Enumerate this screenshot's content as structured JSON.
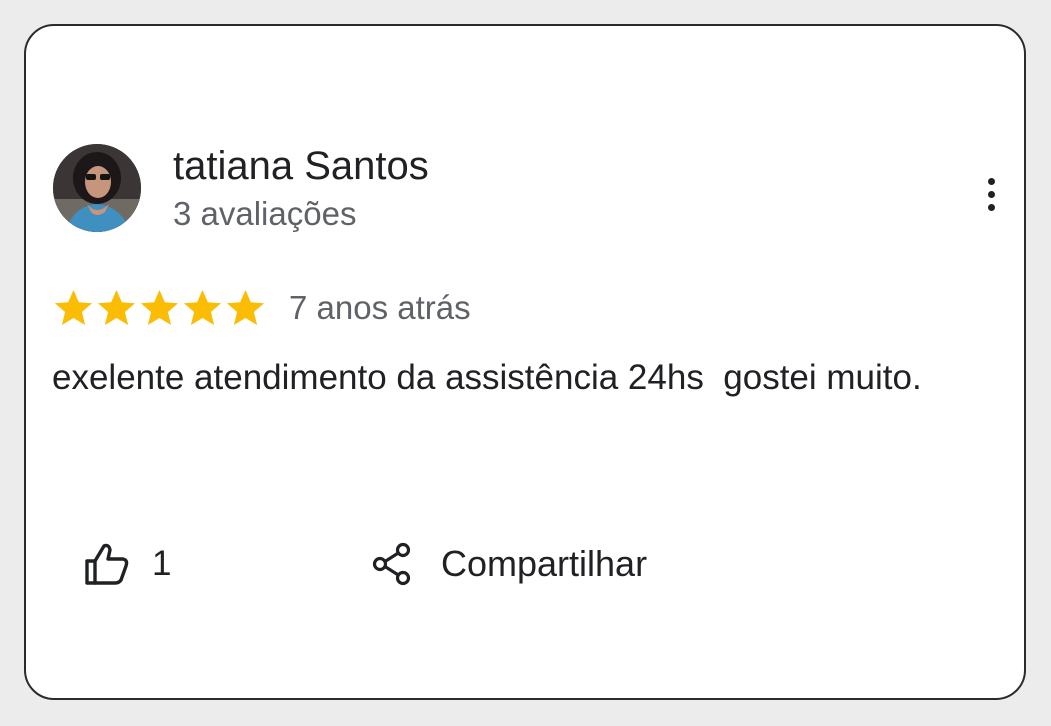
{
  "review": {
    "author_name": "tatiana Santos",
    "author_meta": "3 avaliações",
    "rating": 5,
    "rating_max": 5,
    "date": "7 anos atrás",
    "text": "exelente atendimento da assistência 24hs  gostei muito.",
    "likes": "1",
    "share_label": "Compartilhar"
  },
  "colors": {
    "star": "#fbbc04",
    "text_primary": "#202124",
    "text_secondary": "#5f6368",
    "card_border": "#2b2b2b"
  },
  "icons": {
    "more": "more-vert-icon",
    "like": "thumb-up-icon",
    "share": "share-icon",
    "star": "star-icon"
  }
}
